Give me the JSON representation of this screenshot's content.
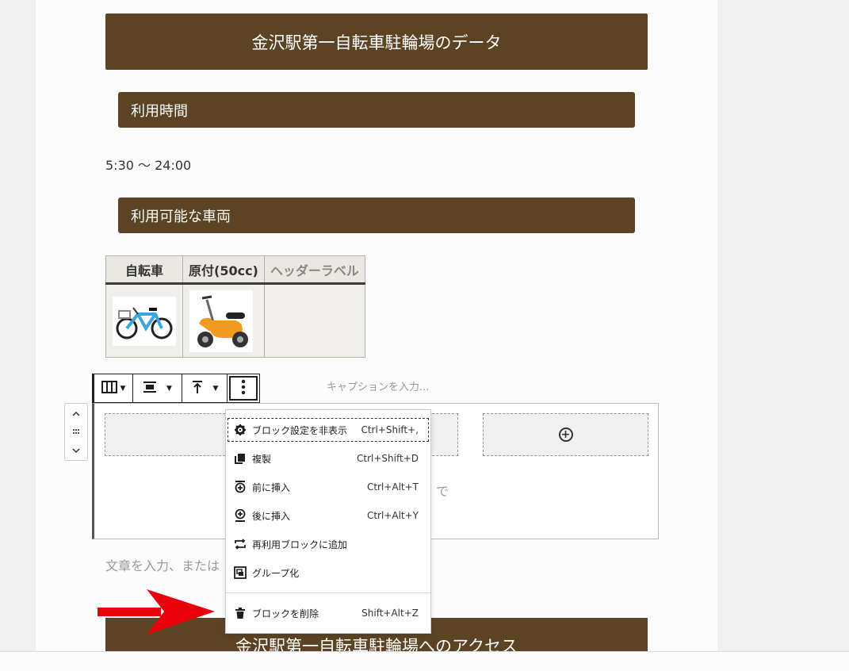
{
  "headings": {
    "data_title": "金沢駅第一自転車駐輪場のデータ",
    "hours_heading": "利用時間",
    "vehicles_heading": "利用可能な車両",
    "access_title": "金沢駅第一自転車駐輪場へのアクセス"
  },
  "hours": "5:30 〜 24:00",
  "table": {
    "headers": [
      "自転車",
      "原付(50cc)",
      "ヘッダーラベル"
    ],
    "images": [
      "bicycle-illustration",
      "scooter-illustration"
    ]
  },
  "caption_placeholder": "キャプションを入力...",
  "paragraph_placeholder": "文章を入力、または",
  "behind_menu_text": "で",
  "toolbar": {
    "icons": [
      "columns-icon",
      "align-icon",
      "vertical-align-icon",
      "more-options-icon"
    ]
  },
  "menu": {
    "items": [
      {
        "label": "ブロック設定を非表示",
        "shortcut": "Ctrl+Shift+,",
        "icon": "gear-icon"
      },
      {
        "label": "複製",
        "shortcut": "Ctrl+Shift+D",
        "icon": "duplicate-icon"
      },
      {
        "label": "前に挿入",
        "shortcut": "Ctrl+Alt+T",
        "icon": "insert-before-icon"
      },
      {
        "label": "後に挿入",
        "shortcut": "Ctrl+Alt+Y",
        "icon": "insert-after-icon"
      },
      {
        "label": "再利用ブロックに追加",
        "shortcut": "",
        "icon": "reusable-icon"
      },
      {
        "label": "グループ化",
        "shortcut": "",
        "icon": "group-icon"
      },
      {
        "label": "ブロックを削除",
        "shortcut": "Shift+Alt+Z",
        "icon": "trash-icon"
      }
    ]
  },
  "colors": {
    "heading_bg": "#5c4324",
    "arrow": "#e8000b"
  }
}
